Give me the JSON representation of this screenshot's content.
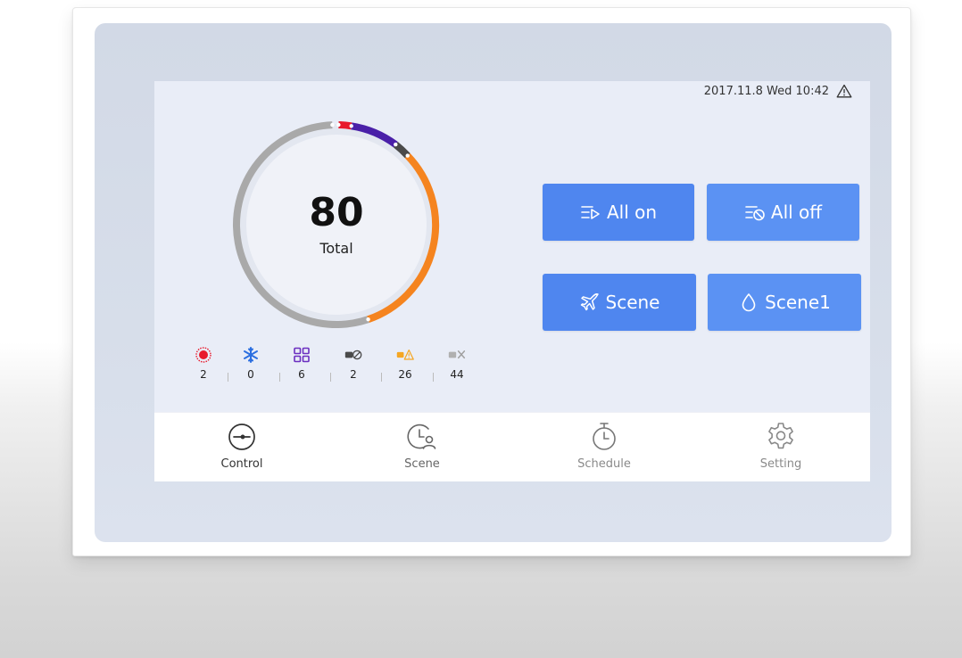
{
  "header": {
    "datetime": "2017.11.8 Wed 10:42",
    "alert_icon": "warning-triangle-icon"
  },
  "summary": {
    "total_value": "80",
    "total_label": "Total",
    "ring_segments": [
      {
        "status": "heating",
        "count": 2,
        "color": "#e8192c"
      },
      {
        "status": "fan",
        "count": 6,
        "color": "#4a20a8"
      },
      {
        "status": "off",
        "count": 2,
        "color": "#4a4a4a"
      },
      {
        "status": "fault",
        "count": 26,
        "color": "#f5841f"
      },
      {
        "status": "offline",
        "count": 44,
        "color": "#a9a9a9"
      }
    ]
  },
  "status_counts": [
    {
      "icon": "sun-heating-icon",
      "value": "2",
      "color": "#e8192c"
    },
    {
      "icon": "snowflake-cooling-icon",
      "value": "0",
      "color": "#2c6fe0"
    },
    {
      "icon": "fan-grid-icon",
      "value": "6",
      "color": "#6b2fc0"
    },
    {
      "icon": "unit-off-icon",
      "value": "2",
      "color": "#4a4a4a"
    },
    {
      "icon": "unit-warning-icon",
      "value": "26",
      "color": "#f5a623"
    },
    {
      "icon": "unit-offline-icon",
      "value": "44",
      "color": "#b0b0b0"
    }
  ],
  "actions": {
    "all_on": {
      "label": "All on",
      "icon": "list-play-icon"
    },
    "all_off": {
      "label": "All off",
      "icon": "list-stop-icon"
    },
    "scene": {
      "label": "Scene",
      "icon": "airplane-icon"
    },
    "scene1": {
      "label": "Scene1",
      "icon": "water-drop-icon"
    }
  },
  "nav": [
    {
      "label": "Control",
      "icon": "control-dial-icon",
      "active": true
    },
    {
      "label": "Scene",
      "icon": "clock-person-icon",
      "active": false
    },
    {
      "label": "Schedule",
      "icon": "stopwatch-icon",
      "active": false
    },
    {
      "label": "Setting",
      "icon": "gear-icon",
      "active": false
    }
  ],
  "colors": {
    "accent": "#4f86ef",
    "nav_active": "#333333",
    "nav_inactive": "#8a8a8a"
  }
}
